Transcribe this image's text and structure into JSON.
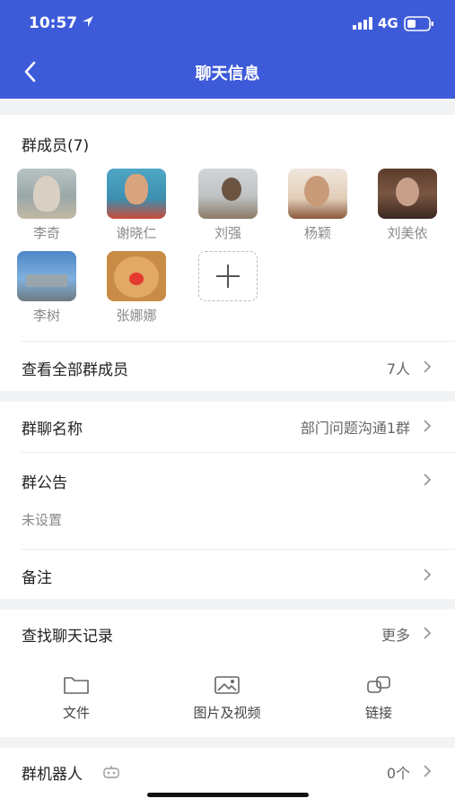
{
  "status_bar": {
    "time": "10:57",
    "network": "4G"
  },
  "header": {
    "title": "聊天信息"
  },
  "members": {
    "title": "群成员(7)",
    "list": [
      {
        "name": "李奇"
      },
      {
        "name": "谢晓仁"
      },
      {
        "name": "刘强"
      },
      {
        "name": "杨颖"
      },
      {
        "name": "刘美依"
      },
      {
        "name": "李树"
      },
      {
        "name": "张娜娜"
      }
    ],
    "view_all_label": "查看全部群成员",
    "view_all_count": "7人"
  },
  "group": {
    "name_label": "群聊名称",
    "name_value": "部门问题沟通1群",
    "notice_label": "群公告",
    "notice_value": "未设置",
    "remark_label": "备注"
  },
  "history": {
    "label": "查找聊天记录",
    "more": "更多",
    "items": [
      {
        "label": "文件",
        "icon": "folder-icon"
      },
      {
        "label": "图片及视频",
        "icon": "image-icon"
      },
      {
        "label": "链接",
        "icon": "link-icon"
      }
    ]
  },
  "robot": {
    "label": "群机器人",
    "value": "0个",
    "icon": "robot-icon"
  },
  "colors": {
    "header": "#3d5bd9",
    "background": "#f2f3f5"
  }
}
